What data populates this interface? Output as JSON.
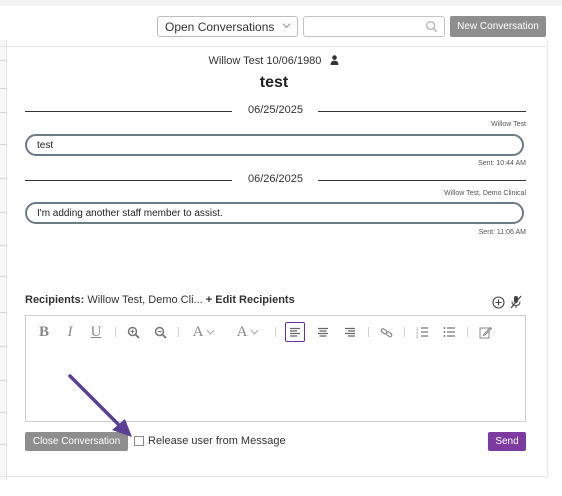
{
  "toolbar": {
    "filter_value": "Open Conversations",
    "search_value": "",
    "new_conversation_label": "New Conversation"
  },
  "conversation": {
    "patient_line": "Willow Test 10/06/1980",
    "subject": "test",
    "messages": [
      {
        "date": "06/25/2025",
        "sender": "Willow Test",
        "text": "test",
        "sent": "Sent: 10:44 AM"
      },
      {
        "date": "06/26/2025",
        "sender": "Willow Test, Demo Clinical",
        "text": "I'm adding another staff member to assist.",
        "sent": "Sent: 11:06 AM"
      }
    ]
  },
  "composer": {
    "recipients_label": "Recipients:",
    "recipients_value": "Willow Test, Demo Cli...",
    "edit_recipients_label": "+ Edit Recipients",
    "editor_text": "",
    "close_label": "Close Conversation",
    "release_label": "Release user from Message",
    "release_checked": false,
    "send_label": "Send"
  },
  "colors": {
    "accent_purple": "#7d3aa0",
    "button_gray": "#8e8e8e",
    "bubble_border": "#6b7b83",
    "annotation_arrow": "#5b3f93"
  },
  "icons": {
    "person": "person-icon",
    "search": "search-icon",
    "add_circle": "add-circle-icon",
    "mic_off": "mic-off-icon",
    "annotation": "annotation-arrow"
  }
}
